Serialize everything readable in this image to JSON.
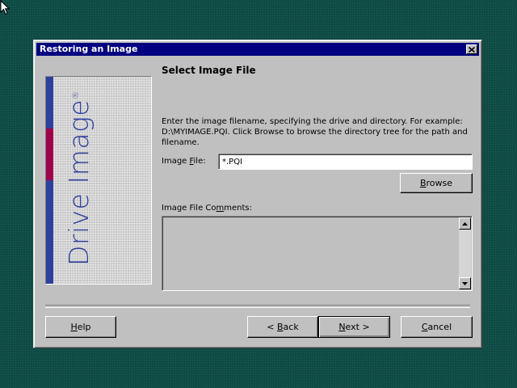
{
  "window": {
    "title": "Restoring an Image"
  },
  "logo": {
    "wordmark": "Drive Image",
    "trademark": "®"
  },
  "page": {
    "heading": "Select Image File",
    "description_line1": "Enter the image filename, specifying the drive and directory.  For example:",
    "description_line2": "D:\\MYIMAGE.PQI.  Click Browse to browse the directory tree for the path and",
    "description_line3": "filename."
  },
  "image_file": {
    "label_prefix": "Image ",
    "label_accel": "F",
    "label_suffix": "ile:",
    "value": "*.PQI"
  },
  "browse": {
    "label_accel": "B",
    "label_rest": "rowse"
  },
  "comments": {
    "label_prefix": "Image File Co",
    "label_accel": "m",
    "label_suffix": "ments:",
    "value": ""
  },
  "buttons": {
    "help_accel": "H",
    "help_rest": "elp",
    "back_arrow": "<",
    "back_accel": "B",
    "back_rest": "ack",
    "next_accel": "N",
    "next_rest": "ext",
    "next_arrow": ">",
    "cancel_accel": "C",
    "cancel_rest": "ancel"
  },
  "colors": {
    "desktop": "#0f4a44",
    "titlebar": "#000080",
    "dialog": "#c0c0c0",
    "logo_blue": "#2e3f9c",
    "logo_accent": "#a0004c"
  },
  "icons": {
    "cursor": "arrow-cursor-icon",
    "close": "close-icon",
    "scroll_up": "scroll-up-icon",
    "scroll_down": "scroll-down-icon"
  }
}
